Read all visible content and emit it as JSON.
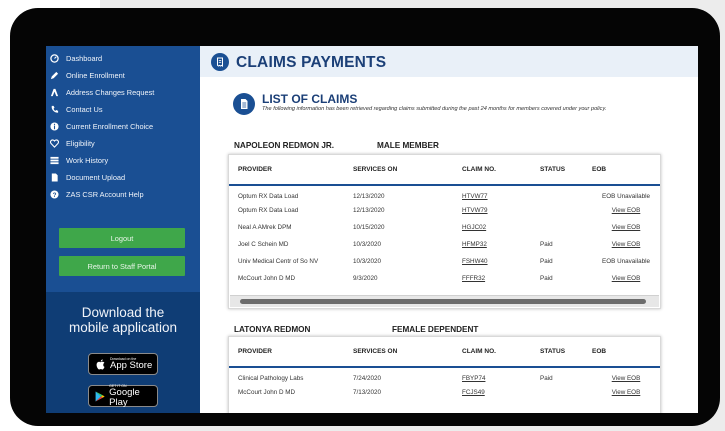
{
  "sidebar": {
    "nav": [
      {
        "label": "Dashboard",
        "icon": "dashboard-icon"
      },
      {
        "label": "Online Enrollment",
        "icon": "pencil-icon"
      },
      {
        "label": "Address Changes Request",
        "icon": "address-icon"
      },
      {
        "label": "Contact Us",
        "icon": "phone-icon"
      },
      {
        "label": "Current Enrollment Choice",
        "icon": "info-icon"
      },
      {
        "label": "Eligibility",
        "icon": "heart-icon"
      },
      {
        "label": "Work History",
        "icon": "list-icon"
      },
      {
        "label": "Document Upload",
        "icon": "document-icon"
      },
      {
        "label": "ZAS CSR Account Help",
        "icon": "help-icon"
      }
    ],
    "logout_label": "Logout",
    "return_label": "Return to Staff Portal",
    "download": {
      "title_line1": "Download the",
      "title_line2": "mobile application",
      "apple_small": "Download on the",
      "apple_big": "App Store",
      "google_small": "GET IT ON",
      "google_big": "Google Play"
    }
  },
  "header": {
    "title": "CLAIMS PAYMENTS"
  },
  "list": {
    "title": "LIST OF CLAIMS",
    "description": "The following information has been retrieved regarding claims submitted during the past 24 months for members covered under your policy."
  },
  "columns": {
    "provider": "PROVIDER",
    "services_on": "SERVICES ON",
    "claim_no": "CLAIM NO.",
    "status": "STATUS",
    "eob": "EOB"
  },
  "members": [
    {
      "name": "NAPOLEON REDMON JR.",
      "type": "MALE MEMBER",
      "rows": [
        {
          "provider": "Optum RX Data Load",
          "services_on": "12/13/2020",
          "claim_no": "HTVW77",
          "status": "",
          "eob": "EOB Unavailable"
        },
        {
          "provider": "Optum RX Data Load",
          "services_on": "12/13/2020",
          "claim_no": "HTVW79",
          "status": "",
          "eob": "View EOB"
        },
        {
          "provider": "Neal A AMrek DPM",
          "services_on": "10/15/2020",
          "claim_no": "HGJC02",
          "status": "",
          "eob": "View EOB"
        },
        {
          "provider": "Joel C Schein MD",
          "services_on": "10/3/2020",
          "claim_no": "HFMP32",
          "status": "Paid",
          "eob": "View EOB"
        },
        {
          "provider": "Univ Medical Centr of So NV",
          "services_on": "10/3/2020",
          "claim_no": "FSHW40",
          "status": "Paid",
          "eob": "EOB Unavailable"
        },
        {
          "provider": "McCourt John D MD",
          "services_on": "9/3/2020",
          "claim_no": "FFFR32",
          "status": "Paid",
          "eob": "View EOB"
        }
      ]
    },
    {
      "name": "LATONYA REDMON",
      "type": "FEMALE DEPENDENT",
      "rows": [
        {
          "provider": "Clinical Pathology Labs",
          "services_on": "7/24/2020",
          "claim_no": "FBYP74",
          "status": "Paid",
          "eob": "View EOB"
        },
        {
          "provider": "McCourt John D MD",
          "services_on": "7/13/2020",
          "claim_no": "FCJS49",
          "status": "",
          "eob": "View EOB"
        }
      ]
    }
  ],
  "colors": {
    "sidebar": "#1a4f93",
    "download_panel": "#0f3d75",
    "green_button": "#3fa74a",
    "title_blue": "#1b3f77",
    "frame": "#050505"
  }
}
